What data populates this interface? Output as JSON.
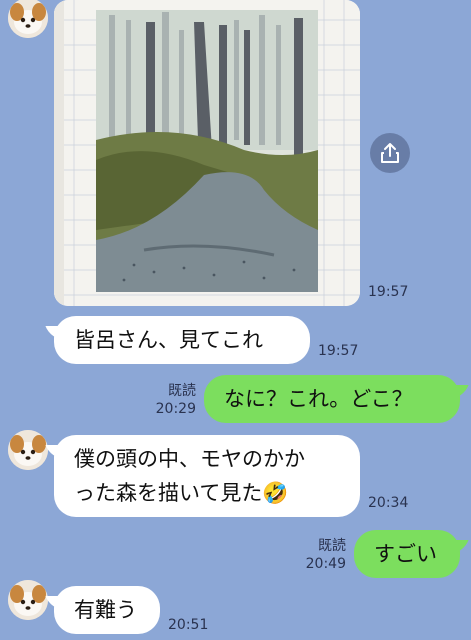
{
  "messages": [
    {
      "id": "m1",
      "side": "in",
      "type": "image",
      "time": "19:57"
    },
    {
      "id": "m2",
      "side": "in",
      "text": "皆呂さん、見てこれ",
      "time": "19:57"
    },
    {
      "id": "m3",
      "side": "out",
      "text": "なに？これ。どこ？",
      "read": "既読",
      "time": "20:29"
    },
    {
      "id": "m4",
      "side": "in",
      "line1": "僕の頭の中、モヤのかか",
      "line2": "った森を描いて見た🤣",
      "time": "20:34"
    },
    {
      "id": "m5",
      "side": "out",
      "text": "すごい",
      "read": "既読",
      "time": "20:49"
    },
    {
      "id": "m6",
      "side": "in",
      "text": "有難う",
      "time": "20:51"
    }
  ],
  "icons": {
    "share": "share-icon",
    "avatar": "dog-avatar"
  },
  "colors": {
    "background": "#8ca7d6",
    "outgoing_bubble": "#7cde5e",
    "incoming_bubble": "#ffffff"
  }
}
